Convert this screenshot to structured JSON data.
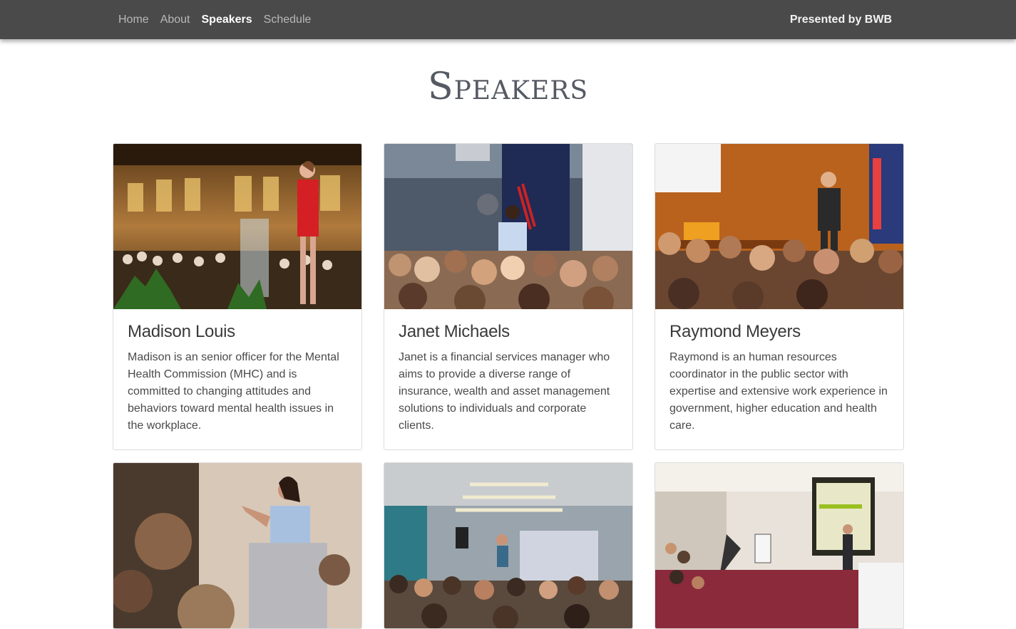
{
  "nav": {
    "links": [
      {
        "label": "Home",
        "active": false
      },
      {
        "label": "About",
        "active": false
      },
      {
        "label": "Speakers",
        "active": true
      },
      {
        "label": "Schedule",
        "active": false
      }
    ],
    "brand": "Presented by BWB"
  },
  "page": {
    "title": "Speakers"
  },
  "speakers": [
    {
      "name": "Madison Louis",
      "bio": "Madison is an senior officer for the Mental Health Commission (MHC) and is committed to changing attitudes and behaviors toward mental health issues in the workplace.",
      "photo_alt": "Woman in red suit speaking at podium in ballroom"
    },
    {
      "name": "Janet Michaels",
      "bio": "Janet is a financial services manager who aims to provide a diverse range of insurance, wealth and asset management solutions to individuals and corporate clients.",
      "photo_alt": "Woman presenting to seated audience beside flag"
    },
    {
      "name": "Raymond Meyers",
      "bio": "Raymond is an human resources coordinator in the public sector with expertise and extensive work experience in government, higher education and health care.",
      "photo_alt": "Man in vest presenting to audience with flags behind"
    },
    {
      "photo_alt": "Woman in blue speaking at lectern"
    },
    {
      "photo_alt": "Speaker presenting in modern conference room"
    },
    {
      "photo_alt": "Man presenting beside projection screen"
    }
  ],
  "colors": {
    "navbar_bg": "#4a4a4a",
    "nav_link": "#b8b8b8",
    "nav_active": "#ffffff",
    "title": "#555a63",
    "card_border": "#dcdcdc"
  }
}
